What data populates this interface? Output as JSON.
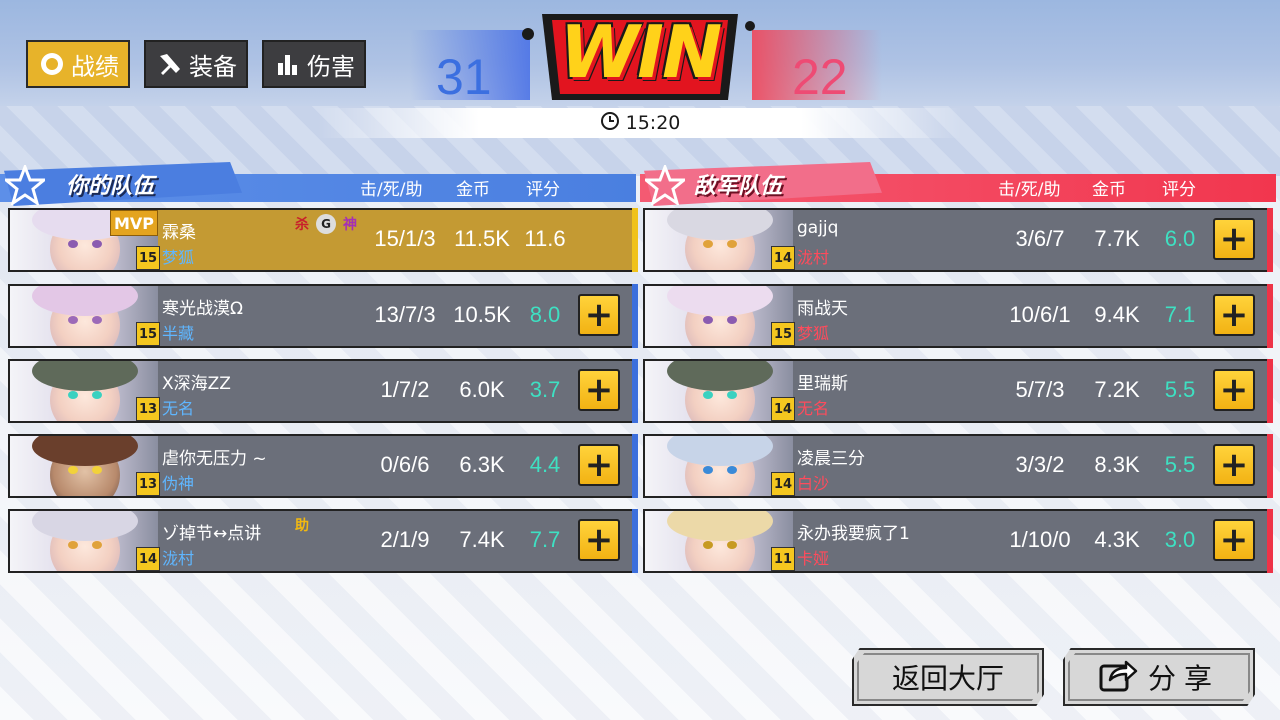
{
  "tabs": [
    {
      "label": "战绩",
      "icon": "record-icon",
      "active": true
    },
    {
      "label": "装备",
      "icon": "equipment-icon",
      "active": false
    },
    {
      "label": "伤害",
      "icon": "bar-chart-icon",
      "active": false
    }
  ],
  "result": {
    "banner": "WIN",
    "ally_score": "31",
    "enemy_score": "22",
    "duration": "15:20"
  },
  "columns": {
    "kda": "击/死/助",
    "gold": "金币",
    "score": "评分"
  },
  "ally_team": {
    "title": "你的队伍",
    "players": [
      {
        "name": "霖桑",
        "hero": "梦狐",
        "level": "15",
        "kda": "15/1/3",
        "gold": "11.5K",
        "score": "11.6",
        "mvp": "MVP",
        "honors": [
          "杀",
          "G",
          "神"
        ]
      },
      {
        "name": "寒光战漠Ω",
        "hero": "半藏",
        "level": "15",
        "kda": "13/7/3",
        "gold": "10.5K",
        "score": "8.0"
      },
      {
        "name": "X深海ZZ",
        "hero": "无名",
        "level": "13",
        "kda": "1/7/2",
        "gold": "6.0K",
        "score": "3.7"
      },
      {
        "name": "虐你无压力 ~",
        "hero": "伪神",
        "level": "13",
        "kda": "0/6/6",
        "gold": "6.3K",
        "score": "4.4"
      },
      {
        "name": "ゾ掉节↔点讲",
        "hero": "泷村",
        "level": "14",
        "kda": "2/1/9",
        "gold": "7.4K",
        "score": "7.7",
        "honors": [
          "助"
        ]
      }
    ]
  },
  "enemy_team": {
    "title": "敌军队伍",
    "players": [
      {
        "name": "gajjq",
        "hero": "泷村",
        "level": "14",
        "kda": "3/6/7",
        "gold": "7.7K",
        "score": "6.0"
      },
      {
        "name": "雨战天",
        "hero": "梦狐",
        "level": "15",
        "kda": "10/6/1",
        "gold": "9.4K",
        "score": "7.1"
      },
      {
        "name": "里瑞斯",
        "hero": "无名",
        "level": "14",
        "kda": "5/7/3",
        "gold": "7.2K",
        "score": "5.5"
      },
      {
        "name": "凌晨三分",
        "hero": "白沙",
        "level": "14",
        "kda": "3/3/2",
        "gold": "8.3K",
        "score": "5.5"
      },
      {
        "name": "永办我要疯了1",
        "hero": "卡娅",
        "level": "11",
        "kda": "1/10/0",
        "gold": "4.3K",
        "score": "3.0"
      }
    ]
  },
  "buttons": {
    "lobby": "返回大厅",
    "share": "分享",
    "add": "+"
  },
  "colors": {
    "ally": "#4b7ee0",
    "enemy": "#f2364e",
    "accent": "#f2b213",
    "score": "#3ee0c2"
  }
}
